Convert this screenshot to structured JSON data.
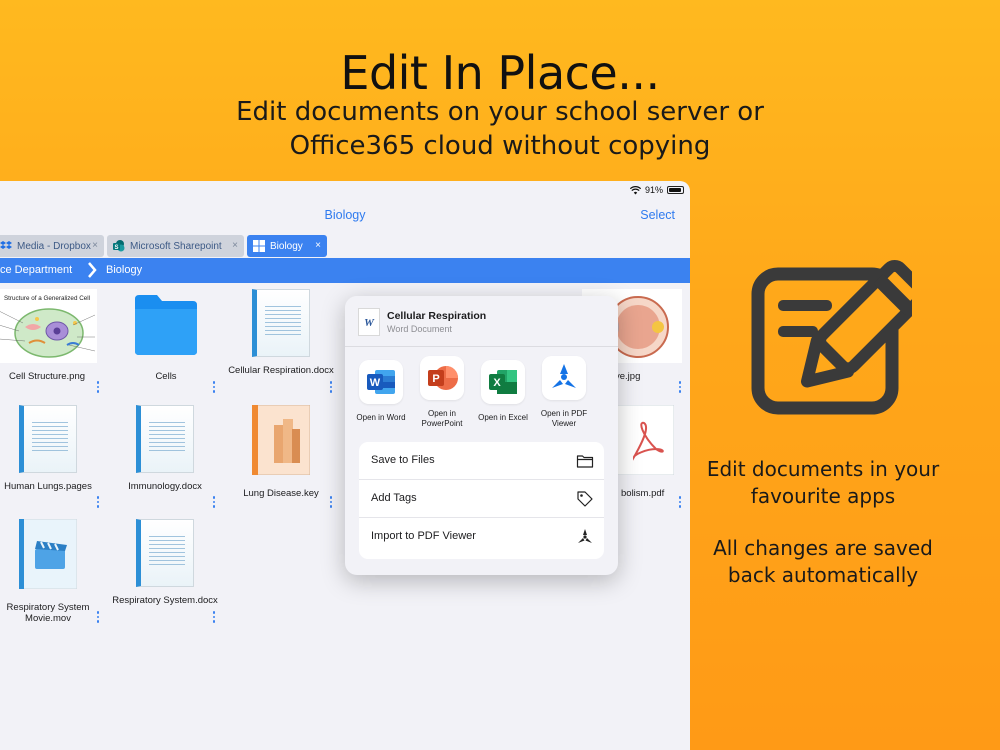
{
  "hero": {
    "title": "Edit In Place...",
    "subtitle_line1": "Edit documents on your school server or",
    "subtitle_line2": "Office365 cloud without copying"
  },
  "side": {
    "icon": "edit-document-icon",
    "text1_line1": "Edit documents in your",
    "text1_line2": "favourite apps",
    "text2_line1": "All changes are saved",
    "text2_line2": "back automatically"
  },
  "status_bar": {
    "battery": "91%",
    "icons": [
      "wifi-icon",
      "battery-icon"
    ]
  },
  "navbar": {
    "title": "Biology",
    "select_label": "Select"
  },
  "tabs": [
    {
      "label": "Media - Dropbox",
      "icon": "dropbox-icon",
      "close": "×"
    },
    {
      "label": "Microsoft Sharepoint",
      "icon": "sharepoint-icon",
      "close": "×"
    },
    {
      "label": "Biology",
      "icon": "windows-icon",
      "close": "×",
      "active": true
    }
  ],
  "breadcrumb": {
    "parent": "ce Department",
    "current": "Biology"
  },
  "files": [
    {
      "name": "Cell Structure.png",
      "type": "image",
      "thumb_label": "Structure of a Generalized Cell"
    },
    {
      "name": "Cells",
      "type": "folder"
    },
    {
      "name": "Cellular Respiration.docx",
      "type": "docx"
    },
    {
      "name": "ve.jpg",
      "type": "image"
    },
    {
      "name": "Human Lungs.pages",
      "type": "pages"
    },
    {
      "name": "Immunology.docx",
      "type": "docx"
    },
    {
      "name": "Lung Disease.key",
      "type": "key"
    },
    {
      "name": "bolism.pdf",
      "type": "pdf"
    },
    {
      "name": "Respiratory System Movie.mov",
      "type": "mov"
    },
    {
      "name": "Respiratory System.docx",
      "type": "docx"
    }
  ],
  "popover": {
    "title": "Cellular Respiration",
    "subtitle": "Word Document",
    "apps": [
      {
        "label": "Open in Word",
        "icon": "word-icon",
        "color": "#185abd"
      },
      {
        "label": "Open in PowerPoint",
        "icon": "powerpoint-icon",
        "color": "#c43e1c"
      },
      {
        "label": "Open in Excel",
        "icon": "excel-icon",
        "color": "#107c41"
      },
      {
        "label": "Open in PDF Viewer",
        "icon": "pdf-viewer-icon",
        "color": "#1473e6"
      }
    ],
    "actions": [
      {
        "label": "Save to Files",
        "icon": "folder-outline-icon"
      },
      {
        "label": "Add Tags",
        "icon": "tag-icon"
      },
      {
        "label": "Import to PDF Viewer",
        "icon": "pdf-viewer-icon"
      }
    ]
  },
  "colors": {
    "accent": "#3b82f0",
    "background": "#ffa81a"
  }
}
